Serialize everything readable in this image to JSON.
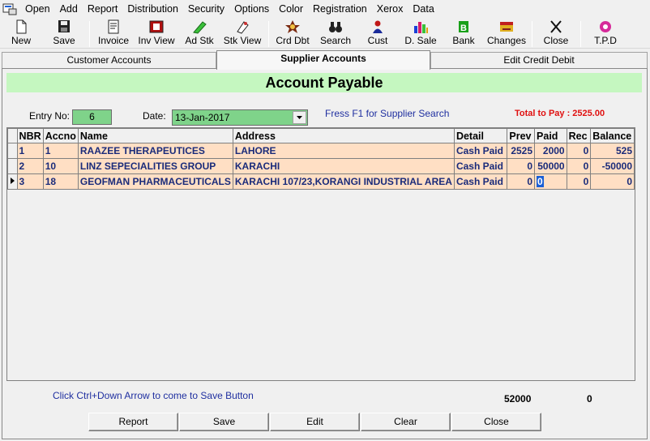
{
  "menu": [
    "Open",
    "Add",
    "Report",
    "Distribution",
    "Security",
    "Options",
    "Color",
    "Registration",
    "Xerox",
    "Data"
  ],
  "toolbar": [
    {
      "label": "New",
      "icon": "new-document-icon"
    },
    {
      "label": "Save",
      "icon": "save-disk-icon"
    },
    {
      "label": "Invoice",
      "icon": "invoice-icon"
    },
    {
      "label": "Inv View",
      "icon": "inv-view-icon"
    },
    {
      "label": "Ad Stk",
      "icon": "add-stock-icon"
    },
    {
      "label": "Stk View",
      "icon": "stock-view-icon"
    },
    {
      "label": "Crd Dbt",
      "icon": "credit-debit-icon"
    },
    {
      "label": "Search",
      "icon": "binoculars-icon"
    },
    {
      "label": "Cust",
      "icon": "customer-icon"
    },
    {
      "label": "D. Sale",
      "icon": "chart-icon"
    },
    {
      "label": "Bank",
      "icon": "bank-icon"
    },
    {
      "label": "Changes",
      "icon": "changes-icon"
    },
    {
      "label": "Close",
      "icon": "close-x-icon"
    },
    {
      "label": "T.P.D",
      "icon": "tpd-icon"
    }
  ],
  "tabs": [
    "Customer Accounts",
    "Supplier Accounts",
    "Edit Credit Debit"
  ],
  "title": "Account Payable",
  "form": {
    "entry_label": "Entry No:",
    "entry_value": "6",
    "date_label": "Date:",
    "date_value": "13-Jan-2017",
    "hint_f1": "Fress F1 for Supplier Search",
    "total": "Total to Pay : 2525.00"
  },
  "grid": {
    "columns": [
      "NBR",
      "Accno",
      "Name",
      "Address",
      "Detail",
      "Prev",
      "Paid",
      "Rec",
      "Balance"
    ],
    "rows": [
      [
        "1",
        "1",
        "RAAZEE THERAPEUTICES",
        "LAHORE",
        "Cash Paid",
        "2525",
        "2000",
        "0",
        "525"
      ],
      [
        "2",
        "10",
        "LINZ  SEPECIALITIES GROUP",
        "KARACHI",
        "Cash Paid",
        "0",
        "50000",
        "0",
        "-50000"
      ],
      [
        "3",
        "18",
        "GEOFMAN PHARMACEUTICALS",
        "KARACHI 107/23,KORANGI INDUSTRIAL AREA",
        "Cash Paid",
        "0",
        "0",
        "0",
        "0"
      ]
    ]
  },
  "bottom_hint": "Click Ctrl+Down Arrow to come to Save Button",
  "totals": {
    "paid": "52000",
    "rec": "0"
  },
  "buttons": [
    "Report",
    "Save",
    "Edit",
    "Clear",
    "Close"
  ]
}
